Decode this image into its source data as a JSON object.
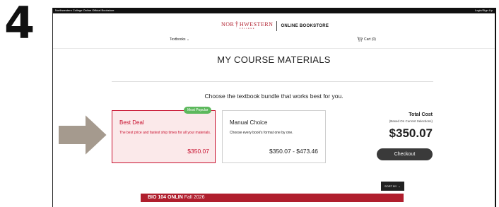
{
  "step_number": "4",
  "topbar": {
    "left_text": "Northwestern College Online Official Bookstore",
    "right_text": "Login/Sign Up"
  },
  "logo": {
    "name_part1": "NOR",
    "name_part2": "HWESTERN",
    "college_text": "COLLEGE",
    "store_text": "ONLINE BOOKSTORE"
  },
  "nav": {
    "textbooks_label": "Textbooks",
    "cart_label": "Cart (0)"
  },
  "page_title": "MY COURSE MATERIALS",
  "subtitle": "Choose the textbook bundle that works best for you.",
  "options": {
    "best": {
      "badge": "Most Popular",
      "title": "Best Deal",
      "description": "The best price and fastest ship times for all your materials.",
      "price": "$350.07"
    },
    "manual": {
      "title": "Manual Choice",
      "description": "Choose every book's format one by one.",
      "price": "$350.07 - $473.46"
    }
  },
  "total": {
    "label": "Total Cost",
    "note": "(Based On Current Selections)",
    "amount": "$350.07",
    "checkout_label": "Checkout"
  },
  "sort": {
    "label": "SORT BY"
  },
  "course": {
    "code": "BIO 104 ONLIN",
    "term": "Fall 2026"
  },
  "colors": {
    "brand_red": "#b01e2d",
    "badge_green": "#5cb85c",
    "button_dark": "#3a3a3a"
  },
  "icons": [
    "chevron-down-icon",
    "cart-icon",
    "arrow-right-icon"
  ]
}
